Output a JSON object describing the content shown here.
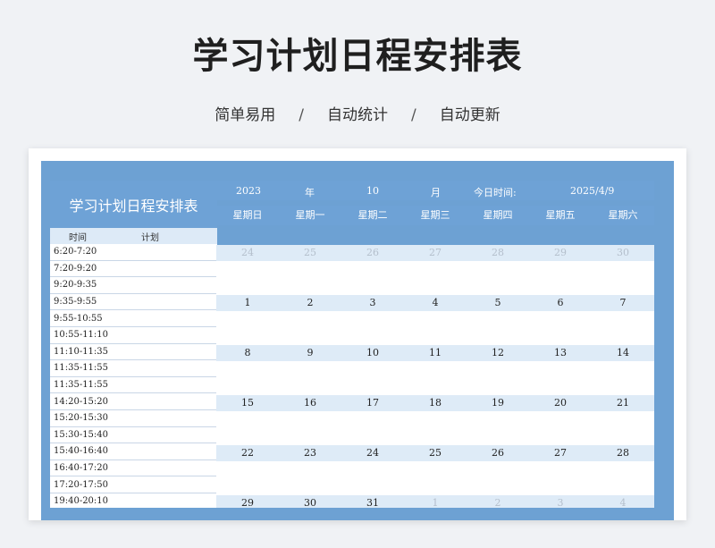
{
  "title": "学习计划日程安排表",
  "subtitle": {
    "items": [
      "简单易用",
      "自动统计",
      "自动更新"
    ],
    "separator": "/"
  },
  "left_panel": {
    "header": "学习计划日程安排表",
    "col_time": "时间",
    "col_plan": "计划",
    "times": [
      "6:20-7:20",
      "7:20-9:20",
      "9:20-9:35",
      "9:35-9:55",
      "9:55-10:55",
      "10:55-11:10",
      "11:10-11:35",
      "11:35-11:55",
      "11:35-11:55",
      "14:20-15:20",
      "15:20-15:30",
      "15:30-15:40",
      "15:40-16:40",
      "16:40-17:20",
      "17:20-17:50",
      "19:40-20:10"
    ]
  },
  "calendar": {
    "year": "2023",
    "year_label": "年",
    "month": "10",
    "month_label": "月",
    "today_label": "今日时间:",
    "today_value": "2025/4/9",
    "weekdays": [
      "星期日",
      "星期一",
      "星期二",
      "星期三",
      "星期四",
      "星期五",
      "星期六"
    ],
    "weeks": [
      [
        {
          "d": "24",
          "other": true
        },
        {
          "d": "25",
          "other": true
        },
        {
          "d": "26",
          "other": true
        },
        {
          "d": "27",
          "other": true
        },
        {
          "d": "28",
          "other": true
        },
        {
          "d": "29",
          "other": true
        },
        {
          "d": "30",
          "other": true
        }
      ],
      [
        {
          "d": "1"
        },
        {
          "d": "2"
        },
        {
          "d": "3"
        },
        {
          "d": "4"
        },
        {
          "d": "5"
        },
        {
          "d": "6"
        },
        {
          "d": "7"
        }
      ],
      [
        {
          "d": "8"
        },
        {
          "d": "9"
        },
        {
          "d": "10"
        },
        {
          "d": "11"
        },
        {
          "d": "12"
        },
        {
          "d": "13"
        },
        {
          "d": "14"
        }
      ],
      [
        {
          "d": "15"
        },
        {
          "d": "16"
        },
        {
          "d": "17"
        },
        {
          "d": "18"
        },
        {
          "d": "19"
        },
        {
          "d": "20"
        },
        {
          "d": "21"
        }
      ],
      [
        {
          "d": "22"
        },
        {
          "d": "23"
        },
        {
          "d": "24"
        },
        {
          "d": "25"
        },
        {
          "d": "26"
        },
        {
          "d": "27"
        },
        {
          "d": "28"
        }
      ],
      [
        {
          "d": "29"
        },
        {
          "d": "30"
        },
        {
          "d": "31"
        },
        {
          "d": "1",
          "other": true
        },
        {
          "d": "2",
          "other": true
        },
        {
          "d": "3",
          "other": true
        },
        {
          "d": "4",
          "other": true
        }
      ]
    ]
  },
  "colors": {
    "accent": "#6ea2d6",
    "light": "#deebf7"
  }
}
